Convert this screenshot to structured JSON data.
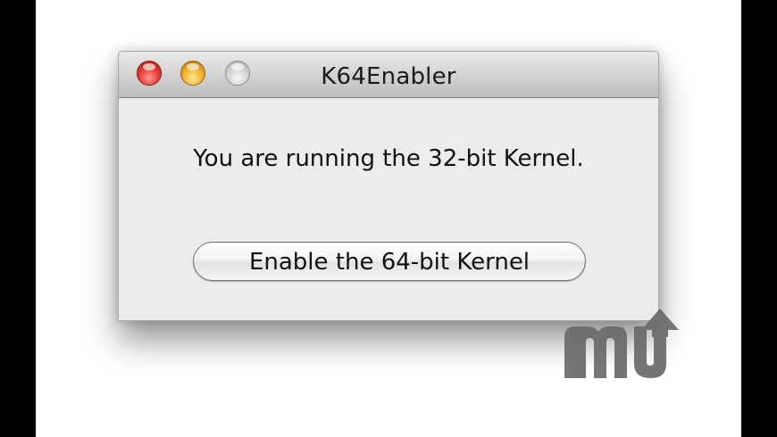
{
  "window": {
    "title": "K64Enabler",
    "controls": {
      "close": "close-icon",
      "minimize": "minimize-icon",
      "zoom": "zoom-icon"
    }
  },
  "main": {
    "message": "You are running the 32-bit Kernel.",
    "button_label": "Enable the 64-bit Kernel"
  },
  "watermark": {
    "icon": "macupdate-logo"
  },
  "colors": {
    "close": "#e8413a",
    "minimize": "#f5b330",
    "zoom": "#d7d7d7",
    "window_background": "#ececec",
    "watermark": "#6a6a6a"
  }
}
